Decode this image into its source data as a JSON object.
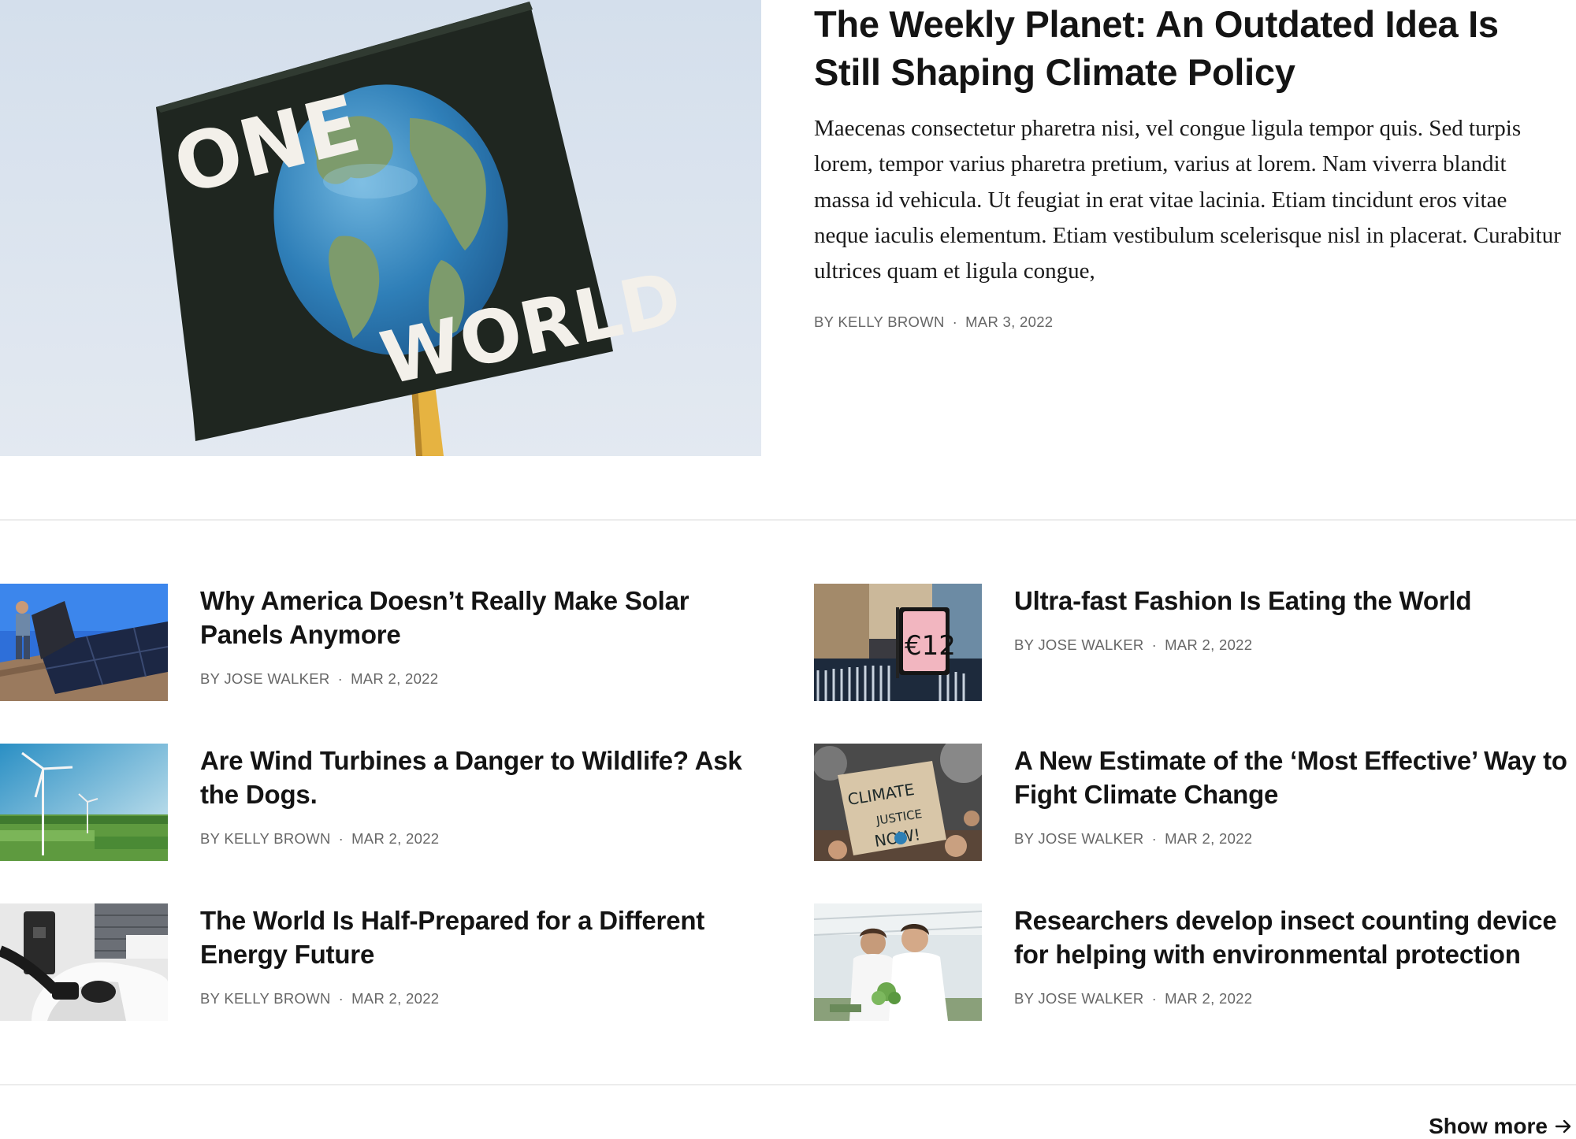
{
  "featured": {
    "title": "The Weekly Planet: An Outdated Idea Is Still Shaping Climate Policy",
    "excerpt": "Maecenas consectetur pharetra nisi, vel congue ligula tempor quis. Sed turpis lorem, tempor varius pharetra pretium, varius at lorem. Nam viverra blandit massa id vehicula. Ut feugiat in erat vitae lacinia. Etiam tincidunt eros vitae neque iaculis elementum. Etiam vestibulum scelerisque nisl in placerat. Curabitur ultrices quam et ligula congue,",
    "author": "BY KELLY BROWN",
    "date": "MAR 3, 2022",
    "sign_text_top": "ONE",
    "sign_text_bottom": "WORLD"
  },
  "articles": [
    {
      "title": "Why America Doesn’t Really Make Solar Panels Anymore",
      "author": "BY JOSE WALKER",
      "date": "MAR 2, 2022"
    },
    {
      "title": "Ultra-fast Fashion Is Eating the World",
      "author": "BY JOSE WALKER",
      "date": "MAR 2, 2022",
      "price_tag": "€12"
    },
    {
      "title": "Are Wind Turbines a Danger to Wildlife? Ask the Dogs.",
      "author": "BY KELLY BROWN",
      "date": "MAR 2, 2022"
    },
    {
      "title": "A New Estimate of the ‘Most Effective’ Way to Fight Climate Change",
      "author": "BY JOSE WALKER",
      "date": "MAR 2, 2022",
      "sign_lines": [
        "CLIMATE",
        "JUSTICE",
        "NOW!"
      ]
    },
    {
      "title": "The World Is Half-Prepared for a Different Energy Future",
      "author": "BY KELLY BROWN",
      "date": "MAR 2, 2022"
    },
    {
      "title": "Researchers develop insect counting device for helping with environmental protection",
      "author": "BY JOSE WALKER",
      "date": "MAR 2, 2022"
    }
  ],
  "show_more": {
    "label": "Show more",
    "icon": "arrow-right-icon"
  }
}
